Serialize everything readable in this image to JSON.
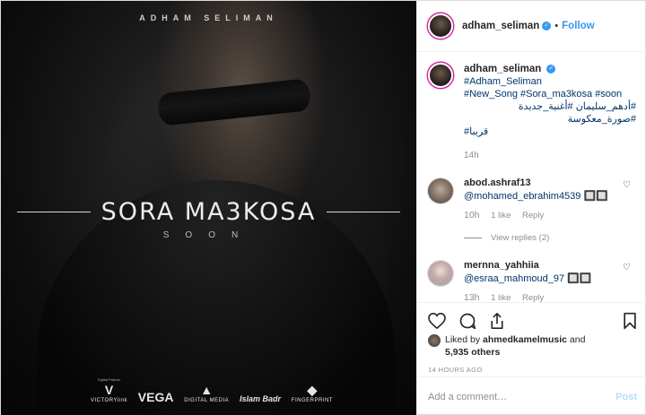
{
  "media": {
    "artist_banner": "Adham Seliman",
    "song_title": "SORA MA3KOSA",
    "soon_text": "SOON",
    "sponsors": [
      {
        "small": "Digital Partner",
        "mark": "V",
        "name": "VICTORYlink"
      },
      {
        "small": "",
        "mark": "VEGA",
        "name": ""
      },
      {
        "small": "",
        "mark": "▲",
        "name": "DIGITAL MEDIA"
      },
      {
        "small": "",
        "mark": "Islam Badr",
        "name": ""
      },
      {
        "small": "",
        "mark": "◆",
        "name": "FINGERPRINT"
      }
    ]
  },
  "header": {
    "username": "adham_seliman",
    "separator": "•",
    "follow_label": "Follow"
  },
  "caption": {
    "username": "adham_seliman",
    "tags_line1": "#Adham_Seliman",
    "tags_line2": "#New_Song #Sora_ma3kosa #soon",
    "arabic_line1": "#أدهم_سليمان #أغنية_جديدة #صورة_معكوسة",
    "arabic_line2": "#قريبا",
    "time": "14h"
  },
  "comments": [
    {
      "username": "abod.ashraf13",
      "text": "@mohamed_ebrahim4539 🔲🔲",
      "time": "10h",
      "likes": "1 like",
      "reply_label": "Reply",
      "view_replies": "View replies (2)"
    },
    {
      "username": "mernna_yahhiia",
      "text": "@esraa_mahmoud_97 🔲🔲",
      "time": "13h",
      "likes": "1 like",
      "reply_label": "Reply"
    }
  ],
  "likes": {
    "prefix": "Liked by",
    "user": "ahmedkamelmusic",
    "conjunction": "and",
    "others": "5,935 others"
  },
  "posted_time": "14 HOURS AGO",
  "add_comment": {
    "placeholder": "Add a comment…",
    "post_label": "Post"
  }
}
